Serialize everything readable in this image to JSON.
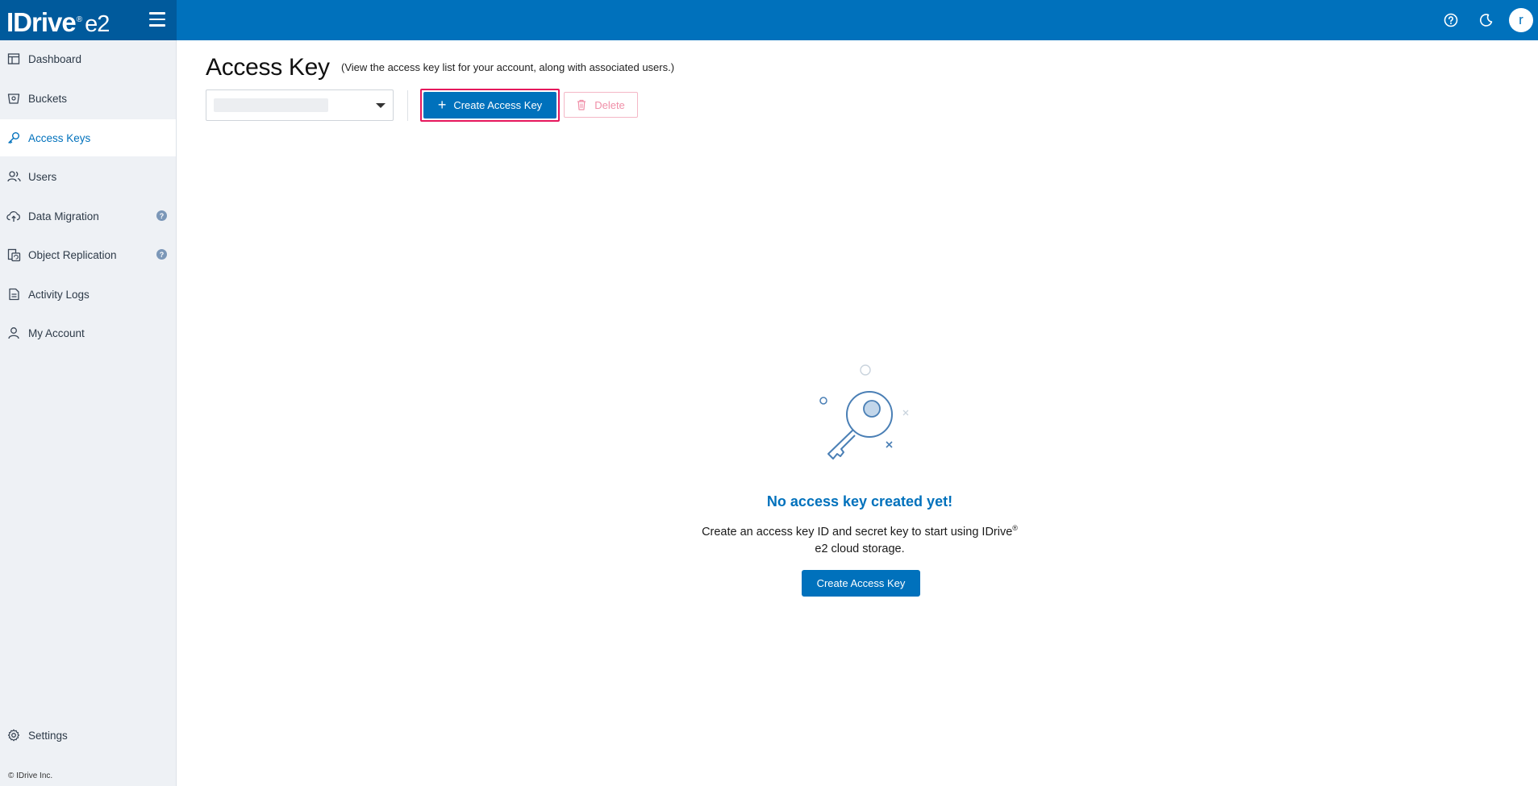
{
  "app": {
    "logo_main": "IDrive",
    "logo_reg": "®",
    "logo_suffix": "e2",
    "user_initial": "r"
  },
  "topbar": {
    "icons": [
      "help-icon",
      "moon-icon",
      "menu-icon"
    ]
  },
  "sidebar": {
    "items": [
      {
        "label": "Dashboard",
        "icon": "dashboard-icon"
      },
      {
        "label": "Buckets",
        "icon": "bucket-icon"
      },
      {
        "label": "Access Keys",
        "icon": "key-icon",
        "active": true
      },
      {
        "label": "Users",
        "icon": "users-icon"
      },
      {
        "label": "Data Migration",
        "icon": "cloud-upload-icon",
        "help": "?"
      },
      {
        "label": "Object Replication",
        "icon": "replication-icon",
        "help": "?"
      },
      {
        "label": "Activity Logs",
        "icon": "document-icon"
      },
      {
        "label": "My Account",
        "icon": "user-icon"
      }
    ],
    "settings": {
      "label": "Settings",
      "icon": "gear-icon"
    },
    "copyright": "© IDrive Inc."
  },
  "main": {
    "title": "Access Key",
    "subtitle": "(View the access key list for your account, along with associated users.)",
    "toolbar": {
      "create_label": "Create Access Key",
      "delete_label": "Delete"
    },
    "empty_state": {
      "title": "No access key created yet!",
      "desc_part1": "Create an access key ID and secret key to start using IDrive",
      "desc_reg": "®",
      "desc_part2": "e2 cloud storage.",
      "button_label": "Create Access Key"
    }
  },
  "colors": {
    "brand": "#0071bc",
    "brand_dark": "#005a9c",
    "highlight": "#e6175c",
    "delete_disabled": "#f08fa8"
  }
}
